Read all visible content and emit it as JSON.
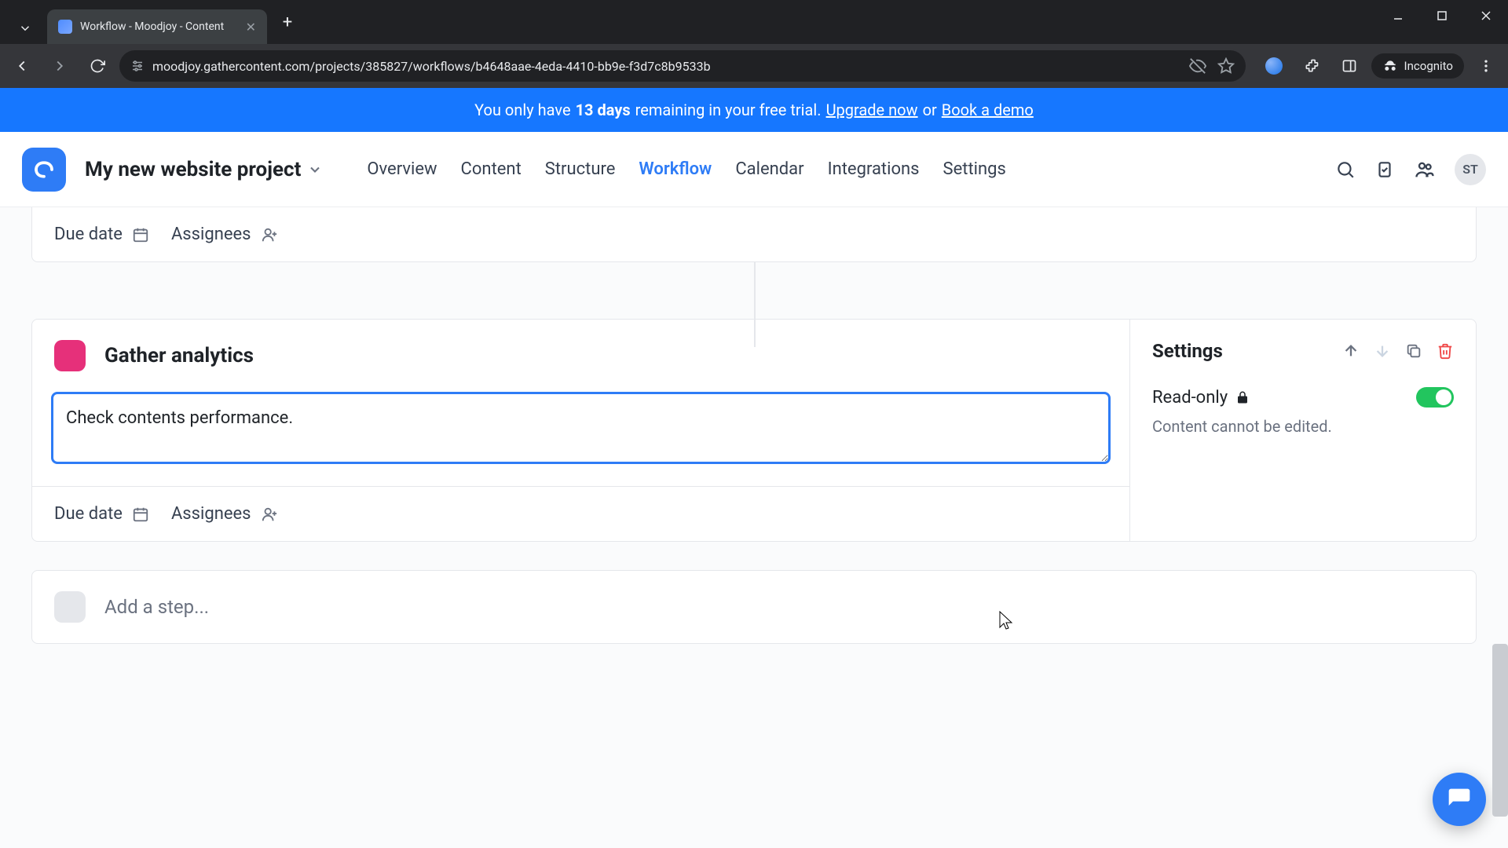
{
  "browser": {
    "tab_title": "Workflow - Moodjoy - Content",
    "url": "moodjoy.gathercontent.com/projects/385827/workflows/b4648aae-4eda-4410-bb9e-f3d7c8b9533b",
    "incognito_label": "Incognito"
  },
  "banner": {
    "pre": "You only have ",
    "days": "13 days",
    "mid": " remaining in your free trial. ",
    "upgrade": "Upgrade now",
    "or": " or ",
    "demo": "Book a demo"
  },
  "header": {
    "project": "My new website project",
    "tabs": [
      "Overview",
      "Content",
      "Structure",
      "Workflow",
      "Calendar",
      "Integrations",
      "Settings"
    ],
    "active_tab": "Workflow",
    "avatar_initials": "ST"
  },
  "prev_step": {
    "due_label": "Due date",
    "assignees_label": "Assignees"
  },
  "step": {
    "title": "Gather analytics",
    "color": "#e6307a",
    "description": "Check contents performance.",
    "due_label": "Due date",
    "assignees_label": "Assignees"
  },
  "settings": {
    "title": "Settings",
    "readonly_label": "Read-only",
    "readonly_on": true,
    "readonly_help": "Content cannot be edited."
  },
  "add_step": {
    "label": "Add a step..."
  }
}
